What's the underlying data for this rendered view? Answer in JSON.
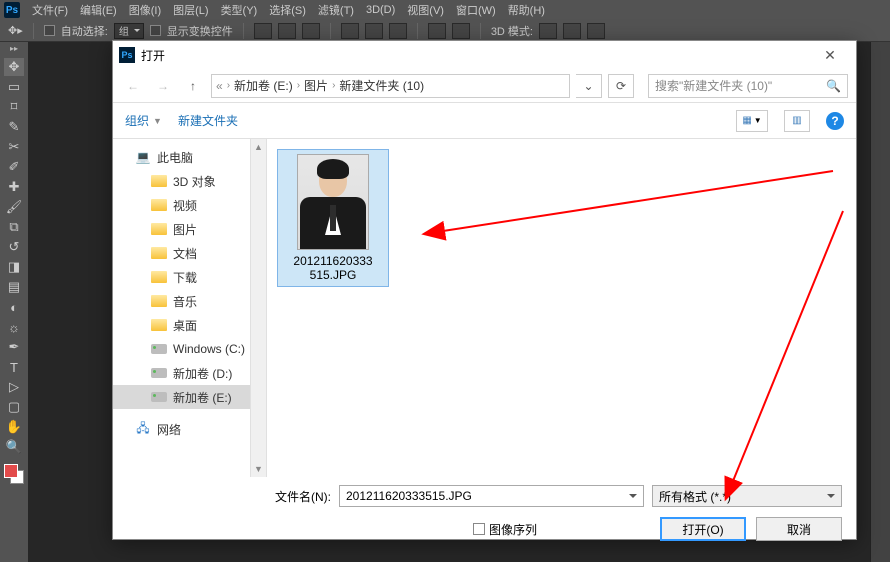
{
  "ps": {
    "logo": "Ps",
    "menu": [
      "文件(F)",
      "编辑(E)",
      "图像(I)",
      "图层(L)",
      "类型(Y)",
      "选择(S)",
      "滤镜(T)",
      "3D(D)",
      "视图(V)",
      "窗口(W)",
      "帮助(H)"
    ],
    "options": {
      "auto_select": "自动选择:",
      "layer_dd": "组",
      "show_transform": "显示变换控件",
      "mode3d": "3D 模式:"
    }
  },
  "dialog": {
    "title": "打开",
    "path": {
      "root_icon": "«",
      "segments": [
        "新加卷 (E:)",
        "图片",
        "新建文件夹 (10)"
      ]
    },
    "search_placeholder": "搜索\"新建文件夹 (10)\"",
    "toolbar": {
      "organize": "组织",
      "new_folder": "新建文件夹"
    },
    "tree": [
      {
        "label": "此电脑",
        "icon": "pc",
        "indent": false
      },
      {
        "label": "3D 对象",
        "icon": "folder",
        "indent": true
      },
      {
        "label": "视频",
        "icon": "folder",
        "indent": true
      },
      {
        "label": "图片",
        "icon": "folder",
        "indent": true
      },
      {
        "label": "文档",
        "icon": "folder",
        "indent": true
      },
      {
        "label": "下载",
        "icon": "folder",
        "indent": true
      },
      {
        "label": "音乐",
        "icon": "folder",
        "indent": true
      },
      {
        "label": "桌面",
        "icon": "folder",
        "indent": true
      },
      {
        "label": "Windows (C:)",
        "icon": "disk",
        "indent": true
      },
      {
        "label": "新加卷 (D:)",
        "icon": "disk",
        "indent": true
      },
      {
        "label": "新加卷 (E:)",
        "icon": "disk",
        "indent": true,
        "selected": true
      },
      {
        "label": "网络",
        "icon": "net",
        "indent": false
      }
    ],
    "file": {
      "name_line1": "201211620333",
      "name_line2": "515.JPG"
    },
    "filename_label": "文件名(N):",
    "filename_value": "201211620333515.JPG",
    "filter_value": "所有格式 (*.*)",
    "image_sequence": "图像序列",
    "open_btn": "打开(O)",
    "cancel_btn": "取消",
    "help": "?"
  }
}
